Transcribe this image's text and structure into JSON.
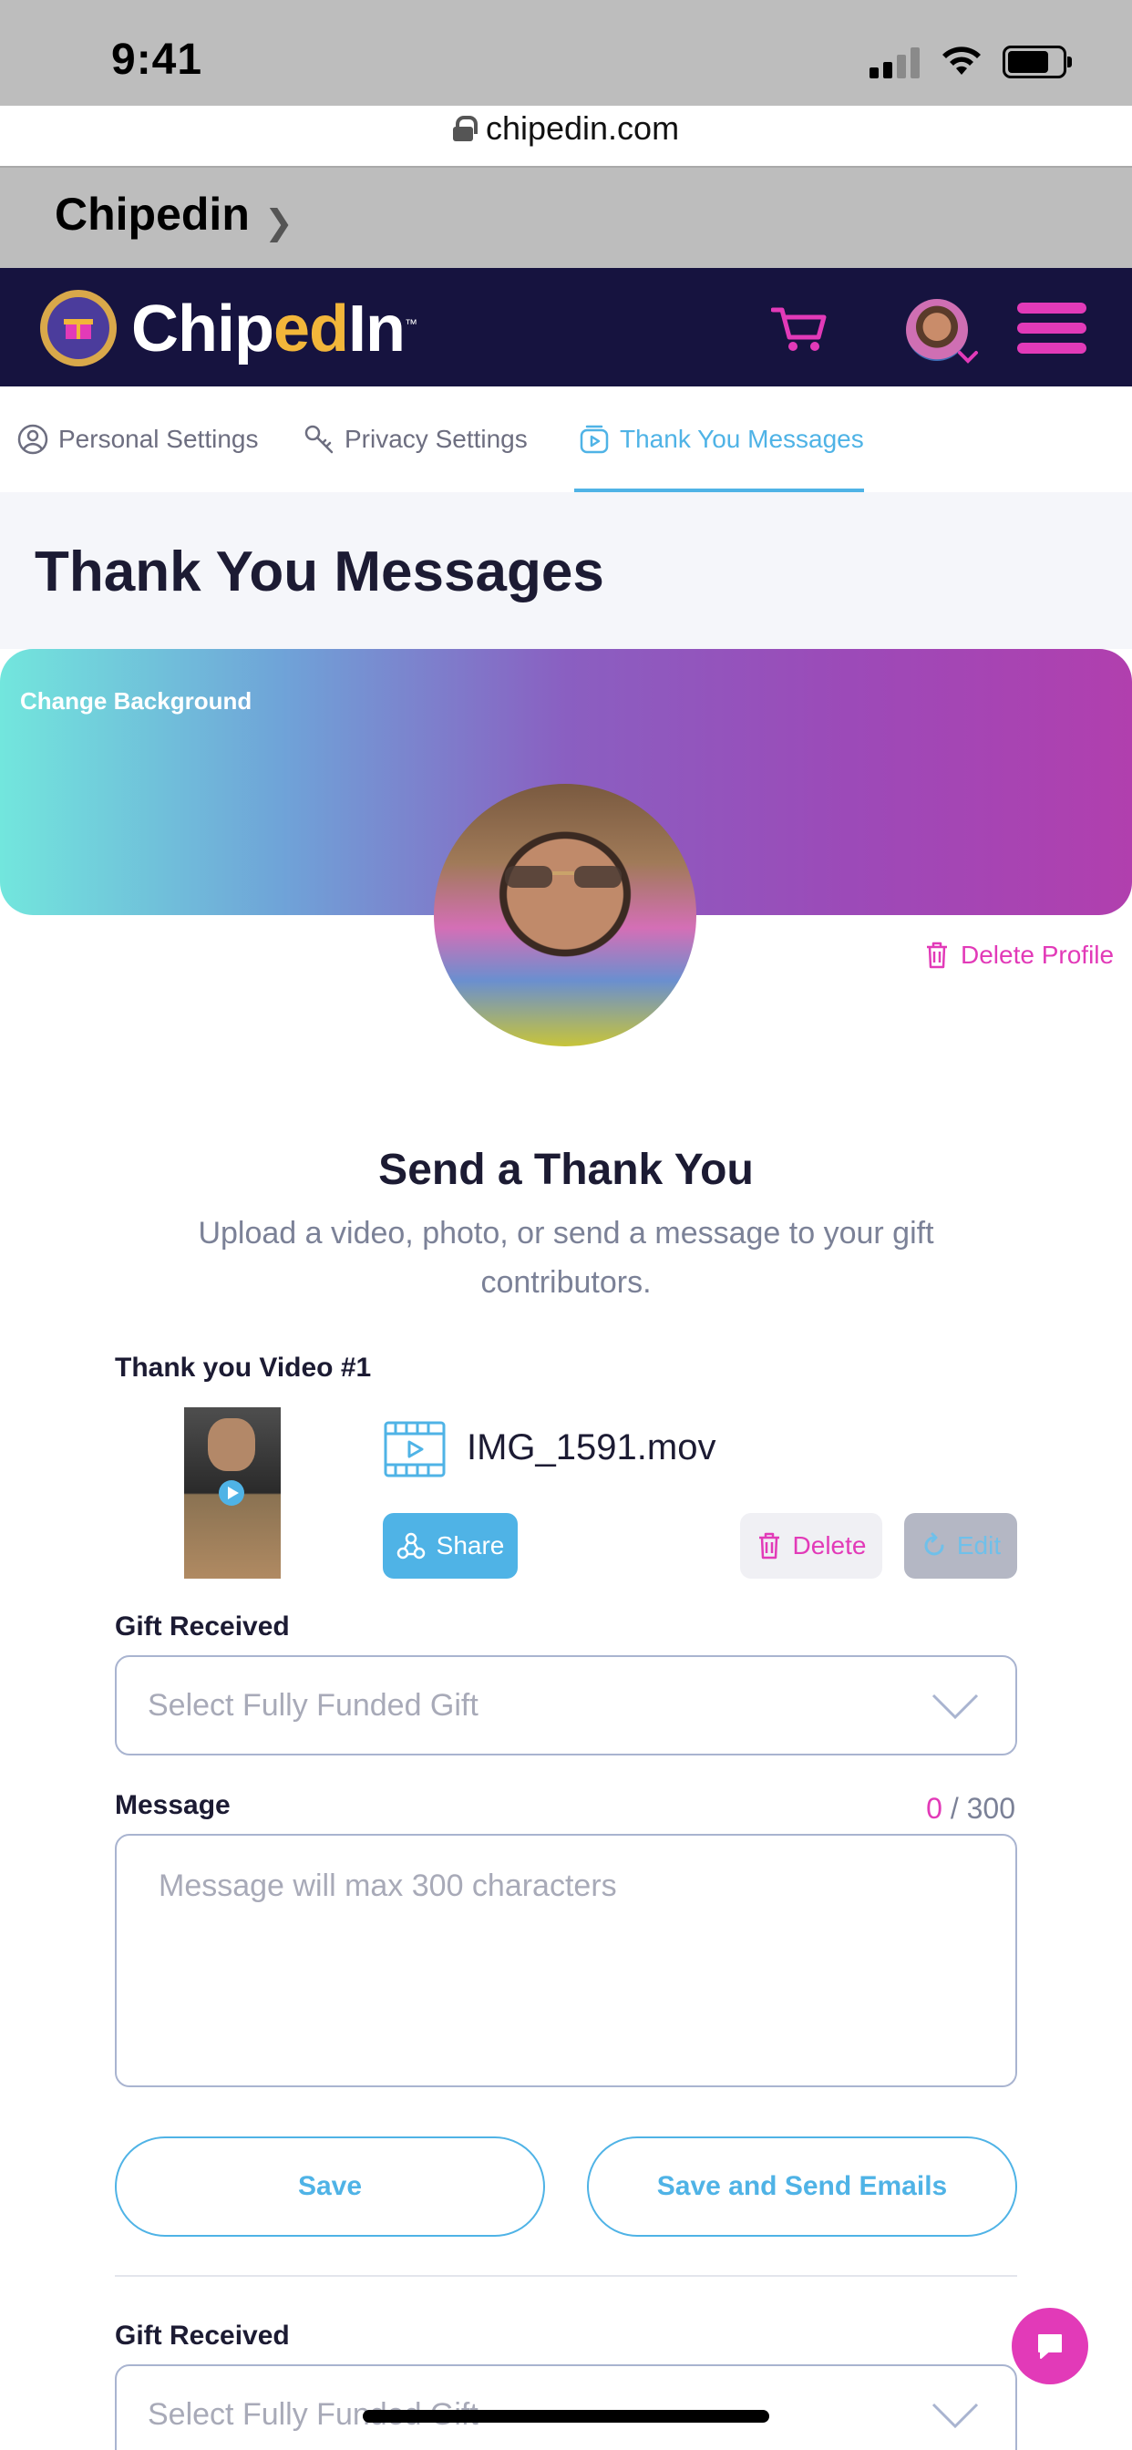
{
  "status_bar": {
    "time": "9:41"
  },
  "browser": {
    "url": "chipedin.com"
  },
  "app_banner": {
    "title": "Chipedin"
  },
  "header": {
    "logo": {
      "part1": "Chip",
      "part2": "ed",
      "part3": "In",
      "tm": "™"
    },
    "colors": {
      "background": "#16133f",
      "accent": "#e23ab8",
      "logo_gold": "#f2b63a"
    }
  },
  "tabs": [
    {
      "label": "Personal Settings",
      "icon": "user-circle-icon",
      "active": false
    },
    {
      "label": "Privacy Settings",
      "icon": "key-icon",
      "active": false
    },
    {
      "label": "Thank You Messages",
      "icon": "video-message-icon",
      "active": true
    }
  ],
  "page": {
    "title": "Thank You Messages",
    "change_background": "Change Background",
    "delete_profile": "Delete Profile"
  },
  "send": {
    "heading": "Send a Thank You",
    "subtitle": "Upload a video, photo, or send a message to your gift contributors."
  },
  "video": {
    "label": "Thank you Video #1",
    "file_name": "IMG_1591.mov",
    "share": "Share",
    "delete": "Delete",
    "edit": "Edit"
  },
  "form": {
    "gift_label": "Gift Received",
    "gift_placeholder": "Select Fully Funded Gift",
    "message_label": "Message",
    "message_count": "0",
    "message_max": "/ 300",
    "message_placeholder": "Message will max 300 characters",
    "save": "Save",
    "save_send": "Save and Send Emails"
  },
  "form2": {
    "gift_label": "Gift Received",
    "gift_placeholder": "Select Fully Funded Gift"
  }
}
